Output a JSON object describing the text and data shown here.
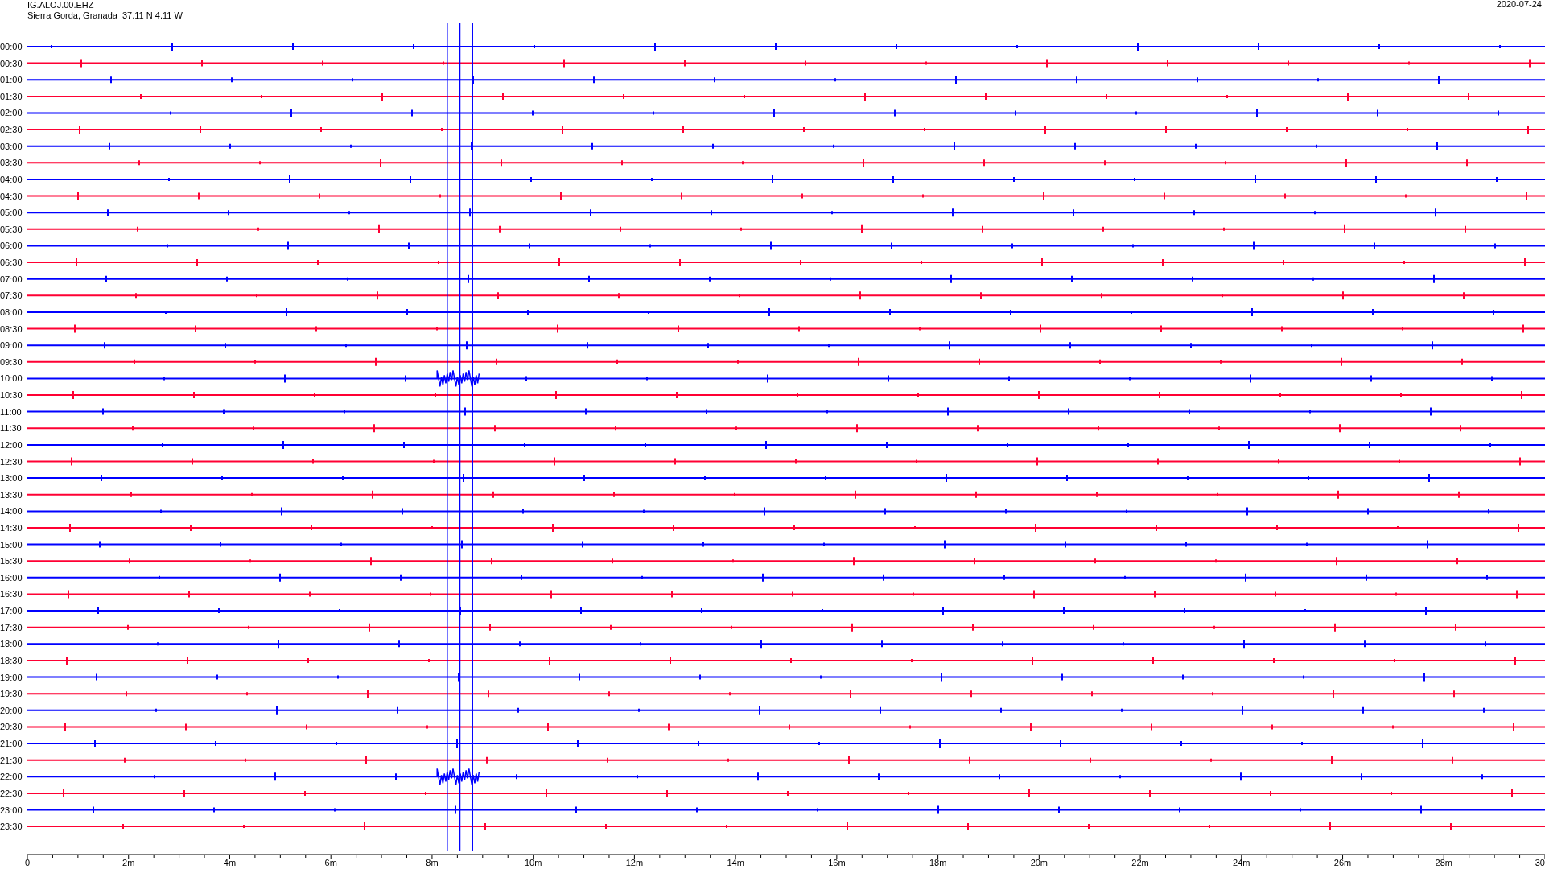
{
  "header": {
    "station": "IG.ALOJ.00.EHZ",
    "location": "Sierra Gorda, Granada  37.11 N 4.11 W",
    "date": "2020-07-24"
  },
  "traces": [
    {
      "label": "00:00",
      "color": "#0000ff"
    },
    {
      "label": "00:30",
      "color": "#ff0033"
    },
    {
      "label": "01:00",
      "color": "#0000ff"
    },
    {
      "label": "01:30",
      "color": "#ff0033"
    },
    {
      "label": "02:00",
      "color": "#0000ff"
    },
    {
      "label": "02:30",
      "color": "#ff0033"
    },
    {
      "label": "03:00",
      "color": "#0000ff"
    },
    {
      "label": "03:30",
      "color": "#ff0033"
    },
    {
      "label": "04:00",
      "color": "#0000ff"
    },
    {
      "label": "04:30",
      "color": "#ff0033"
    },
    {
      "label": "05:00",
      "color": "#0000ff"
    },
    {
      "label": "05:30",
      "color": "#ff0033"
    },
    {
      "label": "06:00",
      "color": "#0000ff"
    },
    {
      "label": "06:30",
      "color": "#ff0033"
    },
    {
      "label": "07:00",
      "color": "#0000ff"
    },
    {
      "label": "07:30",
      "color": "#ff0033"
    },
    {
      "label": "08:00",
      "color": "#0000ff"
    },
    {
      "label": "08:30",
      "color": "#ff0033"
    },
    {
      "label": "09:00",
      "color": "#0000ff"
    },
    {
      "label": "09:30",
      "color": "#ff0033"
    },
    {
      "label": "10:00",
      "color": "#0000ff"
    },
    {
      "label": "10:30",
      "color": "#ff0033"
    },
    {
      "label": "11:00",
      "color": "#0000ff"
    },
    {
      "label": "11:30",
      "color": "#ff0033"
    },
    {
      "label": "12:00",
      "color": "#0000ff"
    },
    {
      "label": "12:30",
      "color": "#ff0033"
    },
    {
      "label": "13:00",
      "color": "#0000ff"
    },
    {
      "label": "13:30",
      "color": "#ff0033"
    },
    {
      "label": "14:00",
      "color": "#0000ff"
    },
    {
      "label": "14:30",
      "color": "#ff0033"
    },
    {
      "label": "15:00",
      "color": "#0000ff"
    },
    {
      "label": "15:30",
      "color": "#ff0033"
    },
    {
      "label": "16:00",
      "color": "#0000ff"
    },
    {
      "label": "16:30",
      "color": "#ff0033"
    },
    {
      "label": "17:00",
      "color": "#0000ff"
    },
    {
      "label": "17:30",
      "color": "#ff0033"
    },
    {
      "label": "18:00",
      "color": "#0000ff"
    },
    {
      "label": "18:30",
      "color": "#ff0033"
    },
    {
      "label": "19:00",
      "color": "#0000ff"
    },
    {
      "label": "19:30",
      "color": "#ff0033"
    },
    {
      "label": "20:00",
      "color": "#0000ff"
    },
    {
      "label": "20:30",
      "color": "#ff0033"
    },
    {
      "label": "21:00",
      "color": "#0000ff"
    },
    {
      "label": "21:30",
      "color": "#ff0033"
    },
    {
      "label": "22:00",
      "color": "#0000ff"
    },
    {
      "label": "22:30",
      "color": "#ff0033"
    },
    {
      "label": "23:00",
      "color": "#0000ff"
    },
    {
      "label": "23:30",
      "color": "#ff0033"
    }
  ],
  "time_axis": {
    "labels": [
      "0",
      "2m",
      "4m",
      "6m",
      "8m",
      "10m",
      "12m",
      "14m",
      "16m",
      "18m",
      "20m",
      "22m",
      "24m",
      "26m",
      "28m",
      "30"
    ]
  }
}
